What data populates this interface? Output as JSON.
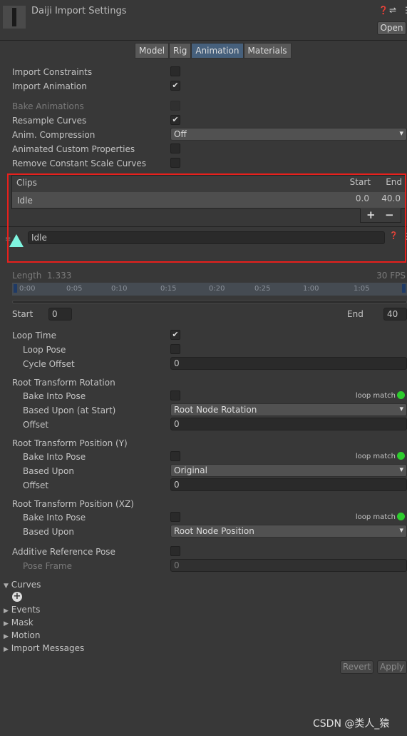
{
  "header": {
    "title": "Daiji Import Settings",
    "open": "Open",
    "help_icon": "help-icon",
    "settings_icon": "sliders-icon",
    "menu_icon": "kebab-icon"
  },
  "tabs": [
    {
      "label": "Model"
    },
    {
      "label": "Rig"
    },
    {
      "label": "Animation",
      "active": true
    },
    {
      "label": "Materials"
    }
  ],
  "settings": {
    "import_constraints": "Import Constraints",
    "import_animation": "Import Animation",
    "bake_animations": "Bake Animations",
    "resample_curves": "Resample Curves",
    "anim_compression": "Anim. Compression",
    "anim_compression_value": "Off",
    "animated_custom_properties": "Animated Custom Properties",
    "remove_constant_scale": "Remove Constant Scale Curves",
    "import_constraints_checked": false,
    "import_animation_checked": true,
    "resample_curves_checked": true
  },
  "clips": {
    "header": "Clips",
    "start_col": "Start",
    "end_col": "End",
    "rows": [
      {
        "name": "Idle",
        "start": "0.0",
        "end": "40.0"
      }
    ],
    "add": "+",
    "remove": "−"
  },
  "clip": {
    "name": "Idle",
    "length_label": "Length",
    "length": "1.333",
    "fps": "30 FPS",
    "ticks": [
      "0:00",
      "0:05",
      "0:10",
      "0:15",
      "0:20",
      "0:25",
      "1:00",
      "1:05"
    ],
    "start_label": "Start",
    "start": "0",
    "end_label": "End",
    "end": "40"
  },
  "loop": {
    "loop_time": "Loop Time",
    "loop_time_checked": true,
    "loop_pose": "Loop Pose",
    "cycle_offset": "Cycle Offset",
    "cycle_offset_value": "0"
  },
  "rot": {
    "title": "Root Transform Rotation",
    "bake": "Bake Into Pose",
    "based": "Based Upon (at Start)",
    "based_value": "Root Node Rotation",
    "offset": "Offset",
    "offset_value": "0",
    "loop_match": "loop match"
  },
  "posy": {
    "title": "Root Transform Position (Y)",
    "bake": "Bake Into Pose",
    "based": "Based Upon",
    "based_value": "Original",
    "offset": "Offset",
    "offset_value": "0",
    "loop_match": "loop match"
  },
  "posxz": {
    "title": "Root Transform Position (XZ)",
    "bake": "Bake Into Pose",
    "based": "Based Upon",
    "based_value": "Root Node Position",
    "loop_match": "loop match"
  },
  "additive": {
    "label": "Additive Reference Pose",
    "pose_frame": "Pose Frame",
    "pose_frame_value": "0"
  },
  "foldouts": {
    "curves": "Curves",
    "events": "Events",
    "mask": "Mask",
    "motion": "Motion",
    "import_messages": "Import Messages"
  },
  "footer": {
    "revert": "Revert",
    "apply": "Apply"
  },
  "watermark": "CSDN @类人_猿",
  "colors": {
    "highlight_border": "#e8201c",
    "active_tab": "#46607c",
    "loop_match_ok": "#2ecc2e",
    "clip_icon": "#7ff5e0"
  }
}
